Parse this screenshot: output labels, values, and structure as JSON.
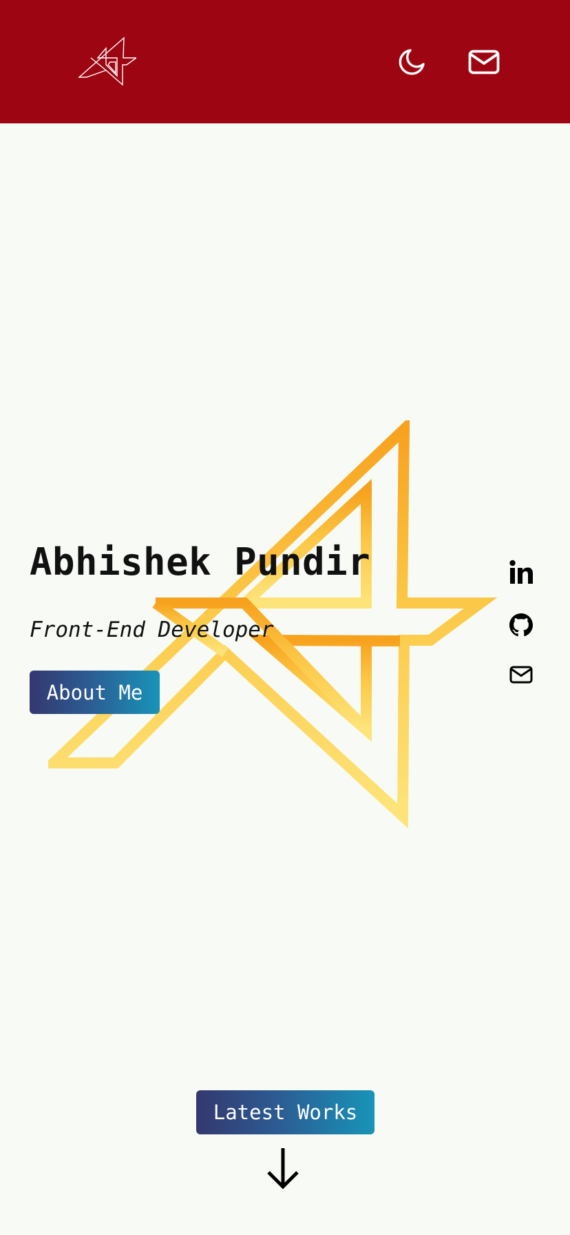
{
  "header": {
    "logo_icon": "a-star-logo-icon",
    "theme_toggle_icon": "moon-icon",
    "contact_icon": "mail-icon",
    "background_color": "#9e0512"
  },
  "hero": {
    "name": "Abhishek Pundir",
    "role": "Front-End Developer",
    "about_button_label": "About Me",
    "background_graphic": "a-star-logo-icon"
  },
  "social": {
    "items": [
      {
        "icon": "linkedin-icon"
      },
      {
        "icon": "github-icon"
      },
      {
        "icon": "mail-icon"
      }
    ]
  },
  "works": {
    "button_label": "Latest Works",
    "scroll_icon": "arrow-down-icon"
  },
  "colors": {
    "page_background": "#f8fbf5",
    "button_gradient_start": "#34386f",
    "button_gradient_end": "#1894b8",
    "graphic_gradient_top": "#f7a21e",
    "graphic_gradient_bottom": "#fde47a"
  }
}
